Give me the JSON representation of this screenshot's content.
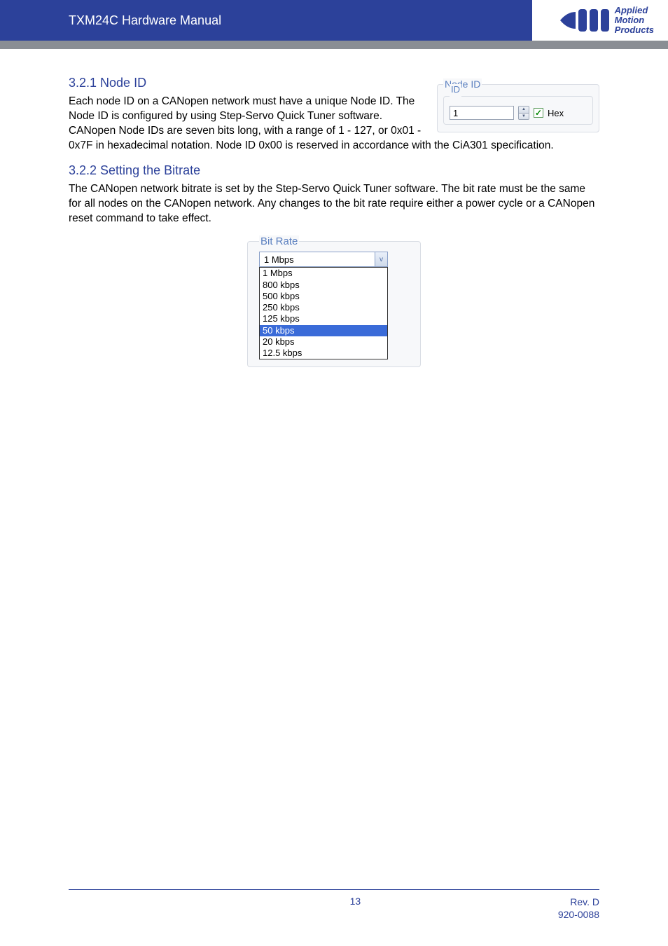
{
  "header": {
    "title": "TXM24C Hardware Manual",
    "logo_text_line1": "Applied",
    "logo_text_line2": "Motion",
    "logo_text_line3": "Products"
  },
  "section1": {
    "heading": "3.2.1  Node ID",
    "body": "Each node ID on a CANopen network must have a unique Node ID. The Node ID is configured by using Step-Servo Quick Tuner software. CANopen Node IDs are seven bits long, with a range of 1 - 127, or 0x01 - 0x7F in hexadecimal notation. Node ID 0x00 is reserved in accordance with the CiA301 specification."
  },
  "node_id_widget": {
    "outer_legend": "Node ID",
    "inner_legend": "ID",
    "value": "1",
    "hex_checked": true,
    "hex_label": "Hex"
  },
  "section2": {
    "heading": "3.2.2  Setting the Bitrate",
    "body": "The CANopen network bitrate is set by the Step-Servo Quick Tuner software. The bit rate must be the same for all nodes on the CANopen network. Any changes to the bit rate require either a power cycle or a CANopen reset command to take effect."
  },
  "bitrate_widget": {
    "legend": "Bit Rate",
    "selected": "1 Mbps",
    "options": [
      "1 Mbps",
      "800 kbps",
      "500 kbps",
      "250 kbps",
      "125 kbps",
      "50 kbps",
      "20 kbps",
      "12.5 kbps"
    ],
    "highlighted_index": 5
  },
  "footer": {
    "page": "13",
    "rev": "Rev. D",
    "docnum": "920-0088"
  }
}
